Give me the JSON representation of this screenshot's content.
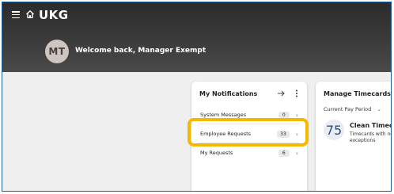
{
  "header": {
    "brand": "UKG",
    "avatar_initials": "MT",
    "welcome": "Welcome back, Manager Exempt",
    "menu_icon": "hamburger-icon",
    "home_icon": "home-icon"
  },
  "notifications": {
    "title": "My Notifications",
    "items": [
      {
        "label": "System Messages",
        "count": "0"
      },
      {
        "label": "Employee Requests",
        "count": "33"
      },
      {
        "label": "My Requests",
        "count": "6"
      }
    ]
  },
  "timecards": {
    "title": "Manage Timecards",
    "period": "Current Pay Period",
    "count": "75",
    "status_title": "Clean Timecar",
    "status_sub": "Timecards with no exceptions"
  },
  "colors": {
    "highlight": "#f5b800",
    "border": "#1f5f96"
  }
}
